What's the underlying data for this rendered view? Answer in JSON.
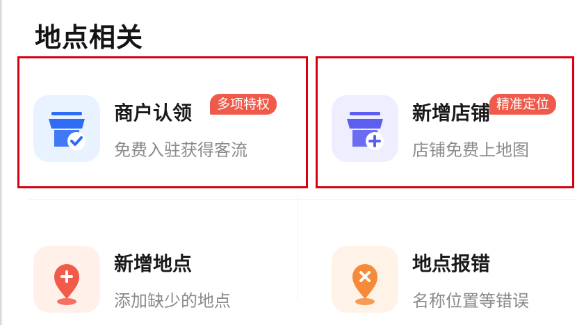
{
  "section": {
    "title": "地点相关"
  },
  "cards": [
    {
      "title": "商户认领",
      "subtitle": "免费入驻获得客流",
      "badge": "多项特权",
      "icon": "shop-check-icon",
      "color": "#2e6cf5"
    },
    {
      "title": "新增店铺",
      "subtitle": "店铺免费上地图",
      "badge": "精准定位",
      "icon": "shop-add-icon",
      "color": "#5b5ef0"
    },
    {
      "title": "新增地点",
      "subtitle": "添加缺少的地点",
      "icon": "location-add-icon",
      "color": "#f25a4a"
    },
    {
      "title": "地点报错",
      "subtitle": "名称位置等错误",
      "icon": "location-error-icon",
      "color": "#f58a3a"
    }
  ],
  "colors": {
    "badge": "#f05a4a",
    "highlight": "#d7000f"
  }
}
